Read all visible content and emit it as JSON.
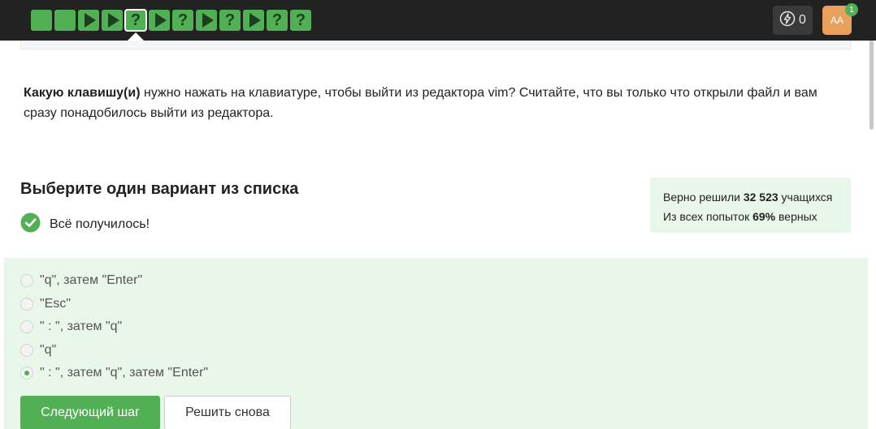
{
  "topbar": {
    "steps": [
      {
        "kind": "done"
      },
      {
        "kind": "done"
      },
      {
        "kind": "play"
      },
      {
        "kind": "play"
      },
      {
        "kind": "question",
        "glyph": "?",
        "current": true
      },
      {
        "kind": "play"
      },
      {
        "kind": "question",
        "glyph": "?"
      },
      {
        "kind": "play"
      },
      {
        "kind": "question",
        "glyph": "?"
      },
      {
        "kind": "play"
      },
      {
        "kind": "question",
        "glyph": "?"
      },
      {
        "kind": "question",
        "glyph": "?"
      }
    ],
    "energy_count": "0",
    "avatar_initials": "AA",
    "notification_count": "1"
  },
  "question": {
    "bold": "Какую клавишу(и)",
    "text": " нужно нажать на клавиатуре, чтобы выйти из редактора vim? Считайте, что вы только что открыли файл и вам сразу понадобилось выйти из редактора."
  },
  "choose_title": "Выберите один вариант из списка",
  "success_text": "Всё получилось!",
  "stats": {
    "line1_prefix": "Верно решили ",
    "line1_value": "32 523",
    "line1_suffix": " учащихся",
    "line2_prefix": "Из всех попыток ",
    "line2_value": "69%",
    "line2_suffix": " верных"
  },
  "options": [
    {
      "label": "\"q\", затем \"Enter\"",
      "checked": false
    },
    {
      "label": "\"Esc\"",
      "checked": false
    },
    {
      "label": "\" : \", затем \"q\"",
      "checked": false
    },
    {
      "label": "\"q\"",
      "checked": false
    },
    {
      "label": "\" : \", затем \"q\", затем \"Enter\"",
      "checked": true
    }
  ],
  "buttons": {
    "next": "Следующий шаг",
    "again": "Решить снова"
  },
  "colors": {
    "topbar": "#222222",
    "accent_green": "#52b054",
    "answers_bg": "#e9f6ea",
    "avatar": "#e9a05d"
  }
}
